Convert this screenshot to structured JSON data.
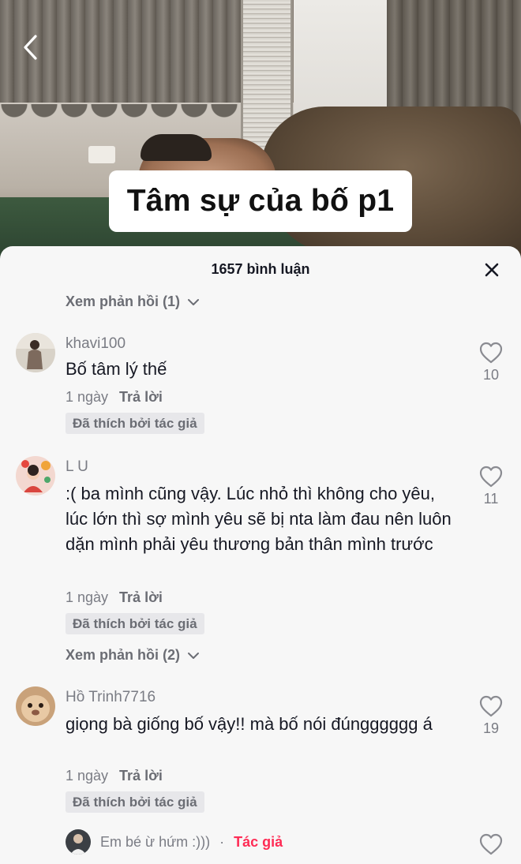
{
  "video": {
    "caption": "Tâm sự của bố p1"
  },
  "nav": {
    "back_icon": "chevron-left-icon"
  },
  "comments_sheet": {
    "count_label": "1657 bình luận",
    "close_icon": "close-icon"
  },
  "view_replies": [
    {
      "label": "Xem phản hồi (1)"
    },
    {
      "label": "Xem phản hồi (2)"
    }
  ],
  "comments": [
    {
      "username": "khavi100",
      "text": "Bố tâm lý thế",
      "time": "1 ngày",
      "reply_label": "Trả lời",
      "liked_by_author": "Đã thích bởi tác giả",
      "likes": "10"
    },
    {
      "username": "L U",
      "text": ":( ba mình cũng vậy. Lúc nhỏ thì không cho yêu, lúc lớn thì sợ mình yêu sẽ bị nta làm đau nên luôn dặn mình phải yêu thương bản thân mình trước",
      "time": "1 ngày",
      "reply_label": "Trả lời",
      "liked_by_author": "Đã thích bởi tác giả",
      "likes": "11"
    },
    {
      "username": "Hồ Trinh7716",
      "text": "giọng bà giống bố vậy!! mà bố nói đúngggggg á",
      "time": "1 ngày",
      "reply_label": "Trả lời",
      "liked_by_author": "Đã thích bởi tác giả",
      "likes": "19"
    }
  ],
  "author_reply": {
    "username": "Em bé ừ hứm :)))",
    "separator": "·",
    "author_tag": "Tác giả"
  },
  "colors": {
    "accent": "#fe2c55",
    "sheet_bg": "#f7f7f7",
    "muted_text": "#7a7c84"
  }
}
